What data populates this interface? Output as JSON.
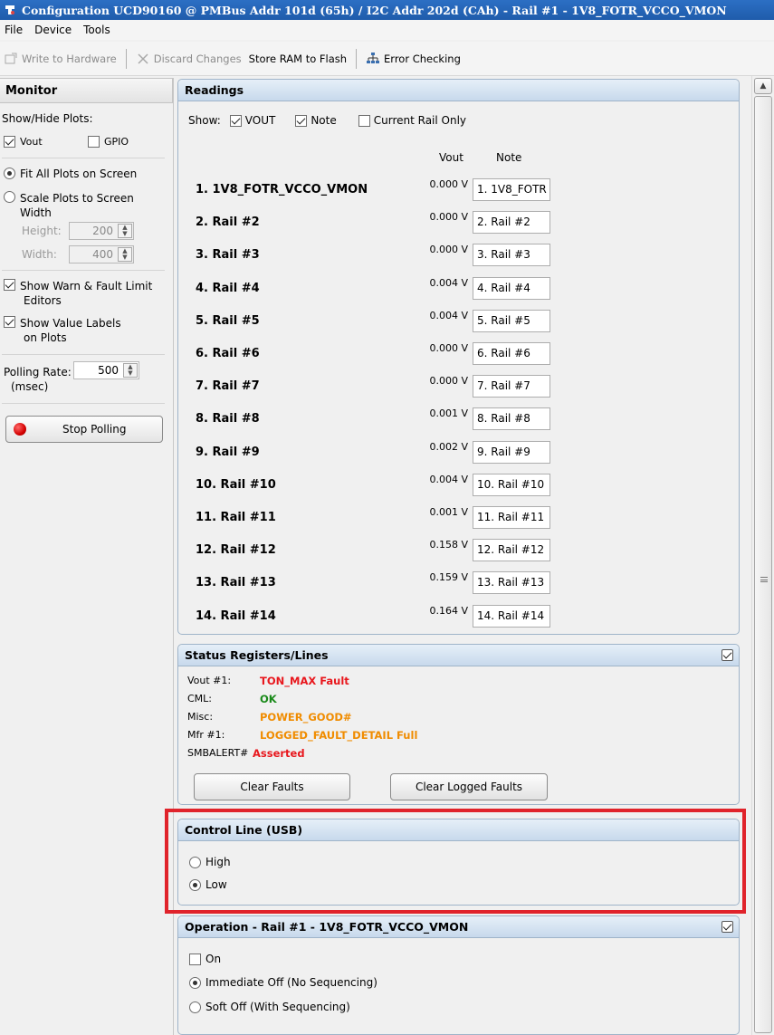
{
  "window": {
    "title": "Configuration UCD90160 @ PMBus Addr 101d (65h) / I2C Addr 202d (CAh)  - Rail #1 - 1V8_FOTR_VCCO_VMON"
  },
  "menu": {
    "items": [
      "File",
      "Device",
      "Tools"
    ]
  },
  "toolbar": {
    "write_label": "Write to Hardware",
    "discard_label": "Discard Changes",
    "store_label": "Store RAM to Flash",
    "error_label": "Error Checking"
  },
  "monitor": {
    "title": "Monitor",
    "show_hide_label": "Show/Hide Plots:",
    "vout_label": "Vout",
    "gpio_label": "GPIO",
    "fit_all_label": "Fit All Plots on Screen",
    "scale_label_1": "Scale Plots to Screen",
    "scale_label_2": "Width",
    "height_label": "Height:",
    "height_value": "200",
    "width_label": "Width:",
    "width_value": "400",
    "warn_label_1": "Show Warn & Fault Limit",
    "warn_label_2": "Editors",
    "value_labels_1": "Show Value Labels",
    "value_labels_2": "on Plots",
    "polling_label_1": "Polling Rate:",
    "polling_label_2": "(msec)",
    "polling_value": "500",
    "stop_label": "Stop Polling",
    "vout_checked": true,
    "gpio_checked": false,
    "fit_all_selected": true,
    "warn_checked": true,
    "value_labels_checked": true
  },
  "readings": {
    "title": "Readings",
    "show_label": "Show:",
    "vout_label": "VOUT",
    "note_label": "Note",
    "current_rail_label": "Current Rail Only",
    "col_vout": "Vout",
    "col_note": "Note",
    "rails": [
      {
        "name": "1. 1V8_FOTR_VCCO_VMON",
        "vout": "0.000 V",
        "note": "1. 1V8_FOTR"
      },
      {
        "name": "2. Rail #2",
        "vout": "0.000 V",
        "note": "2. Rail #2"
      },
      {
        "name": "3. Rail #3",
        "vout": "0.000 V",
        "note": "3. Rail #3"
      },
      {
        "name": "4. Rail #4",
        "vout": "0.004 V",
        "note": "4. Rail #4"
      },
      {
        "name": "5. Rail #5",
        "vout": "0.004 V",
        "note": "5. Rail #5"
      },
      {
        "name": "6. Rail #6",
        "vout": "0.000 V",
        "note": "6. Rail #6"
      },
      {
        "name": "7. Rail #7",
        "vout": "0.000 V",
        "note": "7. Rail #7"
      },
      {
        "name": "8. Rail #8",
        "vout": "0.001 V",
        "note": "8. Rail #8"
      },
      {
        "name": "9. Rail #9",
        "vout": "0.002 V",
        "note": "9. Rail #9"
      },
      {
        "name": "10. Rail #10",
        "vout": "0.004 V",
        "note": "10. Rail #10"
      },
      {
        "name": "11. Rail #11",
        "vout": "0.001 V",
        "note": "11. Rail #11"
      },
      {
        "name": "12. Rail #12",
        "vout": "0.158 V",
        "note": "12. Rail #12"
      },
      {
        "name": "13. Rail #13",
        "vout": "0.159 V",
        "note": "13. Rail #13"
      },
      {
        "name": "14. Rail #14",
        "vout": "0.164 V",
        "note": "14. Rail #14"
      }
    ]
  },
  "status": {
    "title": "Status Registers/Lines",
    "rows": [
      {
        "label": "Vout #1:",
        "value": "TON_MAX Fault",
        "color": "#e8171d"
      },
      {
        "label": "CML:",
        "value": "OK",
        "color": "#1a8a1a"
      },
      {
        "label": "Misc:",
        "value": "POWER_GOOD#",
        "color": "#f08c00"
      },
      {
        "label": "Mfr #1:",
        "value": "LOGGED_FAULT_DETAIL Full",
        "color": "#f08c00"
      },
      {
        "label": "SMBALERT#",
        "value": "Asserted",
        "color": "#e8171d"
      }
    ],
    "clear_faults_label": "Clear Faults",
    "clear_logged_label": "Clear Logged Faults"
  },
  "control_line": {
    "title": "Control Line (USB)",
    "high_label": "High",
    "low_label": "Low",
    "selected": "Low"
  },
  "operation": {
    "title": "Operation - Rail #1 - 1V8_FOTR_VCCO_VMON",
    "on_label": "On",
    "immediate_label": "Immediate Off (No Sequencing)",
    "soft_label": "Soft Off (With Sequencing)",
    "selected": "Immediate Off (No Sequencing)"
  },
  "colors": {
    "highlight": "#e0232b",
    "title_bar": "#2c6fc4",
    "panel_header": "#c7d9ec"
  },
  "icons": {
    "app": "ti-logo-icon",
    "write": "write-hardware-icon",
    "discard": "close-icon",
    "error": "error-checking-icon"
  }
}
